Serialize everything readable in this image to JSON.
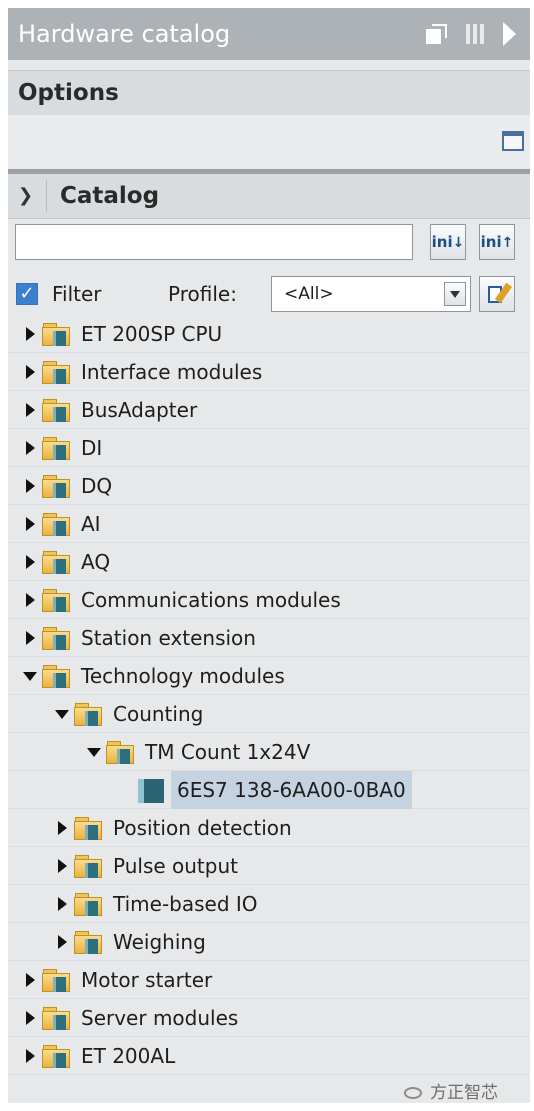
{
  "panel": {
    "title": "Hardware catalog",
    "options_label": "Options",
    "catalog_label": "Catalog"
  },
  "search": {
    "value": "",
    "placeholder": ""
  },
  "buttons": {
    "search_down_label": "ini",
    "search_up_label": "ini"
  },
  "filter": {
    "checked": true,
    "label": "Filter",
    "profile_label": "Profile:",
    "profile_value": "<All>"
  },
  "tree": [
    {
      "label": "ET 200SP CPU",
      "level": 0,
      "state": "collapsed",
      "icon": "folder-icon"
    },
    {
      "label": "Interface modules",
      "level": 0,
      "state": "collapsed",
      "icon": "folder-icon"
    },
    {
      "label": "BusAdapter",
      "level": 0,
      "state": "collapsed",
      "icon": "folder-icon"
    },
    {
      "label": "DI",
      "level": 0,
      "state": "collapsed",
      "icon": "folder-icon"
    },
    {
      "label": "DQ",
      "level": 0,
      "state": "collapsed",
      "icon": "folder-icon"
    },
    {
      "label": "AI",
      "level": 0,
      "state": "collapsed",
      "icon": "folder-icon"
    },
    {
      "label": "AQ",
      "level": 0,
      "state": "collapsed",
      "icon": "folder-icon"
    },
    {
      "label": "Communications modules",
      "level": 0,
      "state": "collapsed",
      "icon": "folder-icon"
    },
    {
      "label": "Station extension",
      "level": 0,
      "state": "collapsed",
      "icon": "folder-icon"
    },
    {
      "label": "Technology modules",
      "level": 0,
      "state": "expanded",
      "icon": "folder-icon"
    },
    {
      "label": "Counting",
      "level": 1,
      "state": "expanded",
      "icon": "folder-icon"
    },
    {
      "label": "TM Count 1x24V",
      "level": 2,
      "state": "expanded",
      "icon": "folder-icon"
    },
    {
      "label": "6ES7 138-6AA00-0BA0",
      "level": 3,
      "state": "leaf",
      "icon": "module-icon",
      "selected": true
    },
    {
      "label": "Position detection",
      "level": 1,
      "state": "collapsed",
      "icon": "folder-icon"
    },
    {
      "label": "Pulse output",
      "level": 1,
      "state": "collapsed",
      "icon": "folder-icon"
    },
    {
      "label": "Time-based IO",
      "level": 1,
      "state": "collapsed",
      "icon": "folder-icon"
    },
    {
      "label": "Weighing",
      "level": 1,
      "state": "collapsed",
      "icon": "folder-icon"
    },
    {
      "label": "Motor starter",
      "level": 0,
      "state": "collapsed",
      "icon": "folder-icon"
    },
    {
      "label": "Server modules",
      "level": 0,
      "state": "collapsed",
      "icon": "folder-icon"
    },
    {
      "label": "ET 200AL",
      "level": 0,
      "state": "collapsed",
      "icon": "folder-icon"
    }
  ],
  "watermark": "方正智芯",
  "colors": {
    "titlebar": "#adb2b7",
    "panel_bg": "#e6e8ea",
    "selection": "#c5d3e0",
    "checkbox": "#3b7fd0"
  }
}
